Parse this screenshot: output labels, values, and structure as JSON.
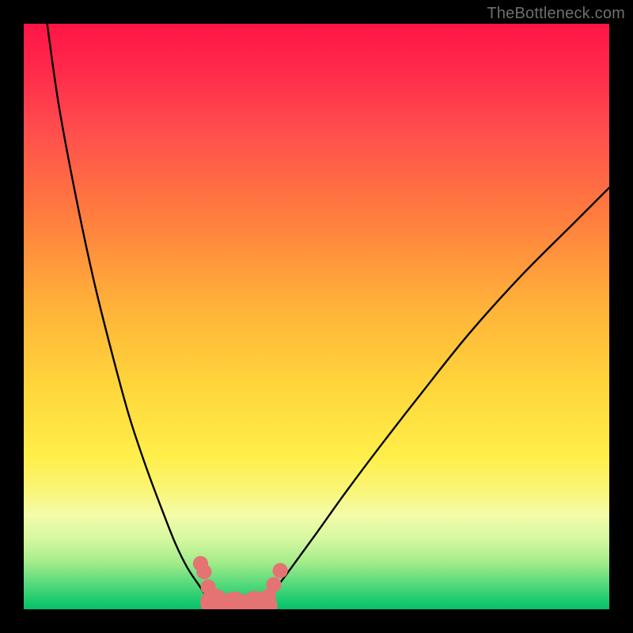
{
  "watermark": "TheBottleneck.com",
  "colors": {
    "frame": "#000000",
    "curve": "#000000",
    "marker_fill": "#e57373",
    "marker_stroke": "#d45a5a",
    "gradient_top": "#ff1547",
    "gradient_bottom": "#0bbf69"
  },
  "chart_data": {
    "type": "line",
    "title": "",
    "xlabel": "",
    "ylabel": "",
    "xlim": [
      0,
      100
    ],
    "ylim": [
      0,
      100
    ],
    "grid": false,
    "legend": false,
    "series": [
      {
        "name": "left-branch",
        "x": [
          4,
          6,
          9,
          12,
          15,
          18,
          21,
          24,
          26,
          28,
          30,
          31,
          32,
          33,
          34
        ],
        "y": [
          100,
          86,
          70,
          56,
          44,
          33,
          24,
          16,
          11,
          7,
          4,
          2.5,
          1.5,
          0.7,
          0.3
        ]
      },
      {
        "name": "right-branch",
        "x": [
          40,
          41,
          43,
          46,
          50,
          55,
          61,
          68,
          76,
          85,
          94,
          100
        ],
        "y": [
          0.3,
          1.2,
          3.5,
          7.5,
          13,
          20,
          28,
          37,
          47,
          57,
          66,
          72
        ]
      }
    ],
    "flat_segment": {
      "name": "bottom-flat",
      "x_start": 32,
      "x_end": 42,
      "y": 0.6
    },
    "markers": [
      {
        "x": 30.2,
        "y": 7.8,
        "r": 1.6
      },
      {
        "x": 30.8,
        "y": 6.4,
        "r": 1.6
      },
      {
        "x": 31.5,
        "y": 3.8,
        "r": 1.6
      },
      {
        "x": 32.6,
        "y": 1.1,
        "r": 3.0
      },
      {
        "x": 36.0,
        "y": 0.6,
        "r": 3.0
      },
      {
        "x": 39.5,
        "y": 0.7,
        "r": 3.0
      },
      {
        "x": 41.8,
        "y": 2.2,
        "r": 1.6
      },
      {
        "x": 42.7,
        "y": 4.2,
        "r": 1.6
      },
      {
        "x": 43.8,
        "y": 6.6,
        "r": 1.6
      }
    ]
  }
}
